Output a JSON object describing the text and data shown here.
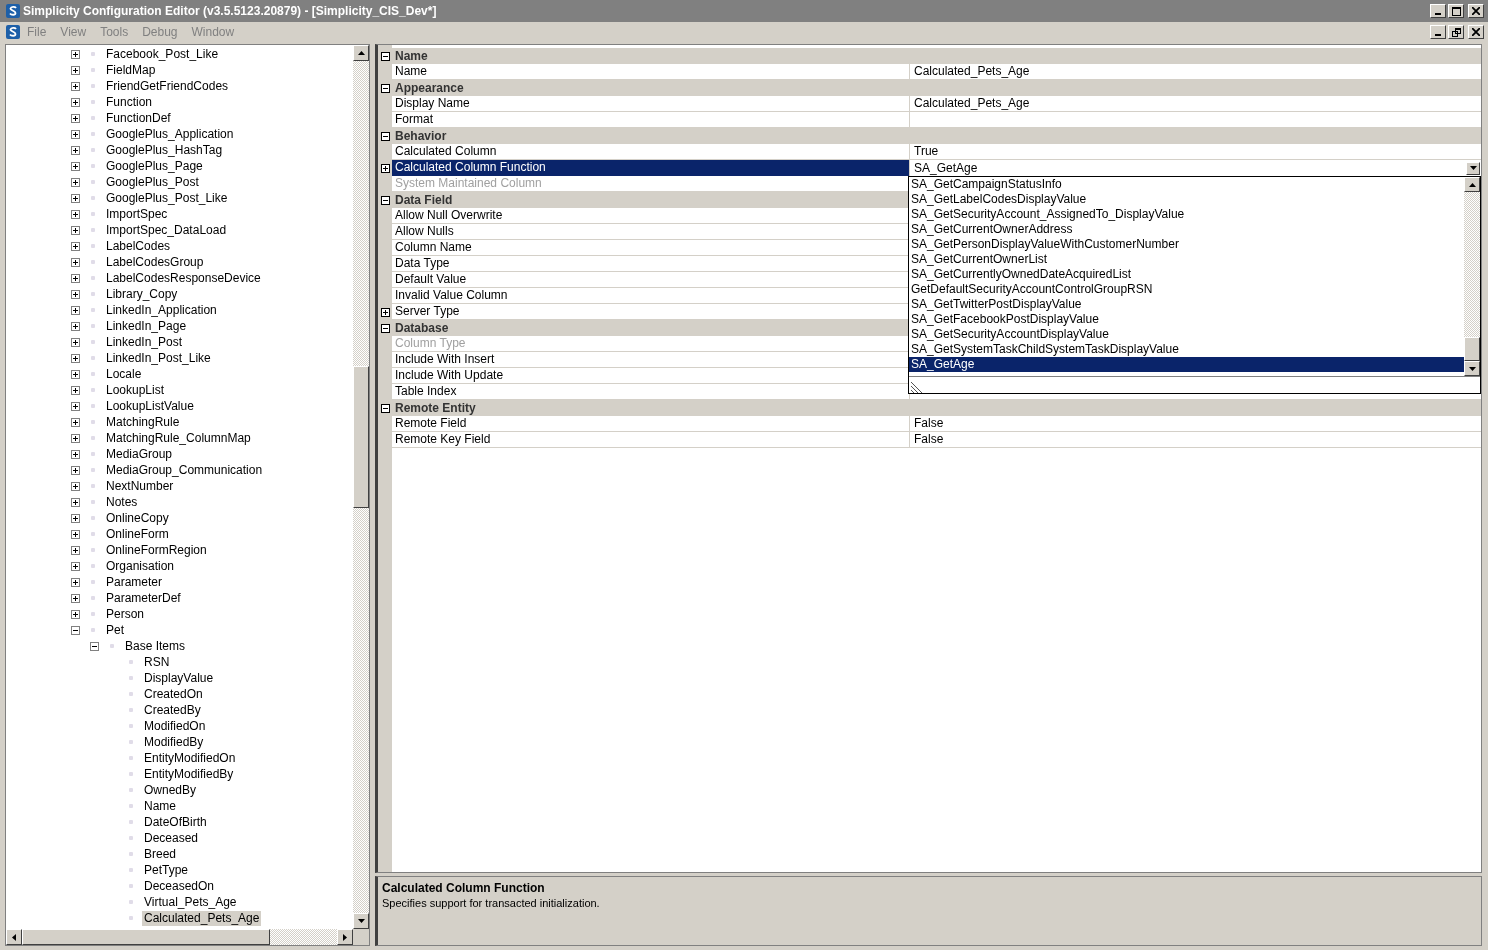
{
  "window": {
    "title": "Simplicity Configuration Editor (v3.5.5123.20879) - [Simplicity_CIS_Dev*]"
  },
  "menu": [
    "File",
    "View",
    "Tools",
    "Debug",
    "Window"
  ],
  "tree": [
    {
      "label": "Facebook_Post_Like",
      "expanded": false
    },
    {
      "label": "FieldMap",
      "expanded": false
    },
    {
      "label": "FriendGetFriendCodes",
      "expanded": false
    },
    {
      "label": "Function",
      "expanded": false
    },
    {
      "label": "FunctionDef",
      "expanded": false
    },
    {
      "label": "GooglePlus_Application",
      "expanded": false
    },
    {
      "label": "GooglePlus_HashTag",
      "expanded": false
    },
    {
      "label": "GooglePlus_Page",
      "expanded": false
    },
    {
      "label": "GooglePlus_Post",
      "expanded": false
    },
    {
      "label": "GooglePlus_Post_Like",
      "expanded": false
    },
    {
      "label": "ImportSpec",
      "expanded": false
    },
    {
      "label": "ImportSpec_DataLoad",
      "expanded": false
    },
    {
      "label": "LabelCodes",
      "expanded": false
    },
    {
      "label": "LabelCodesGroup",
      "expanded": false
    },
    {
      "label": "LabelCodesResponseDevice",
      "expanded": false
    },
    {
      "label": "Library_Copy",
      "expanded": false
    },
    {
      "label": "LinkedIn_Application",
      "expanded": false
    },
    {
      "label": "LinkedIn_Page",
      "expanded": false
    },
    {
      "label": "LinkedIn_Post",
      "expanded": false
    },
    {
      "label": "LinkedIn_Post_Like",
      "expanded": false
    },
    {
      "label": "Locale",
      "expanded": false
    },
    {
      "label": "LookupList",
      "expanded": false
    },
    {
      "label": "LookupListValue",
      "expanded": false
    },
    {
      "label": "MatchingRule",
      "expanded": false
    },
    {
      "label": "MatchingRule_ColumnMap",
      "expanded": false
    },
    {
      "label": "MediaGroup",
      "expanded": false
    },
    {
      "label": "MediaGroup_Communication",
      "expanded": false
    },
    {
      "label": "NextNumber",
      "expanded": false
    },
    {
      "label": "Notes",
      "expanded": false
    },
    {
      "label": "OnlineCopy",
      "expanded": false
    },
    {
      "label": "OnlineForm",
      "expanded": false
    },
    {
      "label": "OnlineFormRegion",
      "expanded": false
    },
    {
      "label": "Organisation",
      "expanded": false
    },
    {
      "label": "Parameter",
      "expanded": false
    },
    {
      "label": "ParameterDef",
      "expanded": false
    },
    {
      "label": "Person",
      "expanded": false
    },
    {
      "label": "Pet",
      "expanded": true,
      "children": [
        {
          "label": "Base Items",
          "expanded": true,
          "children": [
            {
              "label": "RSN",
              "selected": false
            },
            {
              "label": "DisplayValue",
              "selected": false
            },
            {
              "label": "CreatedOn",
              "selected": false
            },
            {
              "label": "CreatedBy",
              "selected": false
            },
            {
              "label": "ModifiedOn",
              "selected": false
            },
            {
              "label": "ModifiedBy",
              "selected": false
            },
            {
              "label": "EntityModifiedOn",
              "selected": false
            },
            {
              "label": "EntityModifiedBy",
              "selected": false
            },
            {
              "label": "OwnedBy",
              "selected": false
            },
            {
              "label": "Name",
              "selected": false
            },
            {
              "label": "DateOfBirth",
              "selected": false
            },
            {
              "label": "Deceased",
              "selected": false
            },
            {
              "label": "Breed",
              "selected": false
            },
            {
              "label": "PetType",
              "selected": false
            },
            {
              "label": "DeceasedOn",
              "selected": false
            },
            {
              "label": "Virtual_Pets_Age",
              "selected": false
            },
            {
              "label": "Calculated_Pets_Age",
              "selected": true
            }
          ]
        }
      ]
    }
  ],
  "properties": [
    {
      "category": "Name",
      "expanded": true,
      "rows": [
        {
          "label": "Name",
          "value": "Calculated_Pets_Age"
        }
      ]
    },
    {
      "category": "Appearance",
      "expanded": true,
      "rows": [
        {
          "label": "Display Name",
          "value": "Calculated_Pets_Age"
        },
        {
          "label": "Format"
        }
      ]
    },
    {
      "category": "Behavior",
      "expanded": true,
      "rows": [
        {
          "label": "Calculated Column",
          "value": "True"
        },
        {
          "label": "Calculated Column Function",
          "value": "SA_GetAge",
          "selected": true,
          "expanded": false,
          "dropdown": true
        },
        {
          "label": "System Maintained Column",
          "disabled": true
        }
      ]
    },
    {
      "category": "Data Field",
      "expanded": true,
      "rows": [
        {
          "label": "Allow Null Overwrite"
        },
        {
          "label": "Allow Nulls"
        },
        {
          "label": "Column Name"
        },
        {
          "label": "Data Type"
        },
        {
          "label": "Default Value"
        },
        {
          "label": "Invalid Value Column"
        },
        {
          "label": "Server Type",
          "expanded": false
        }
      ]
    },
    {
      "category": "Database",
      "expanded": true,
      "rows": [
        {
          "label": "Column Type",
          "disabled": true
        },
        {
          "label": "Include With Insert"
        },
        {
          "label": "Include With Update"
        },
        {
          "label": "Table Index"
        }
      ]
    },
    {
      "category": "Remote Entity",
      "expanded": true,
      "rows": [
        {
          "label": "Remote Field",
          "value": "False"
        },
        {
          "label": "Remote Key Field",
          "value": "False"
        }
      ]
    }
  ],
  "dropdown_list": [
    {
      "label": "SA_GetCampaignStatusInfo",
      "selected": false
    },
    {
      "label": "SA_GetLabelCodesDisplayValue",
      "selected": false
    },
    {
      "label": "SA_GetSecurityAccount_AssignedTo_DisplayValue",
      "selected": false
    },
    {
      "label": "SA_GetCurrentOwnerAddress",
      "selected": false
    },
    {
      "label": "SA_GetPersonDisplayValueWithCustomerNumber",
      "selected": false
    },
    {
      "label": "SA_GetCurrentOwnerList",
      "selected": false
    },
    {
      "label": "SA_GetCurrentlyOwnedDateAcquiredList",
      "selected": false
    },
    {
      "label": "GetDefaultSecurityAccountControlGroupRSN",
      "selected": false
    },
    {
      "label": "SA_GetTwitterPostDisplayValue",
      "selected": false
    },
    {
      "label": "SA_GetFacebookPostDisplayValue",
      "selected": false
    },
    {
      "label": "SA_GetSecurityAccountDisplayValue",
      "selected": false
    },
    {
      "label": "SA_GetSystemTaskChildSystemTaskDisplayValue",
      "selected": false
    },
    {
      "label": "SA_GetAge",
      "selected": true
    }
  ],
  "description": {
    "title": "Calculated Column Function",
    "text": "Specifies support for transacted initialization."
  }
}
